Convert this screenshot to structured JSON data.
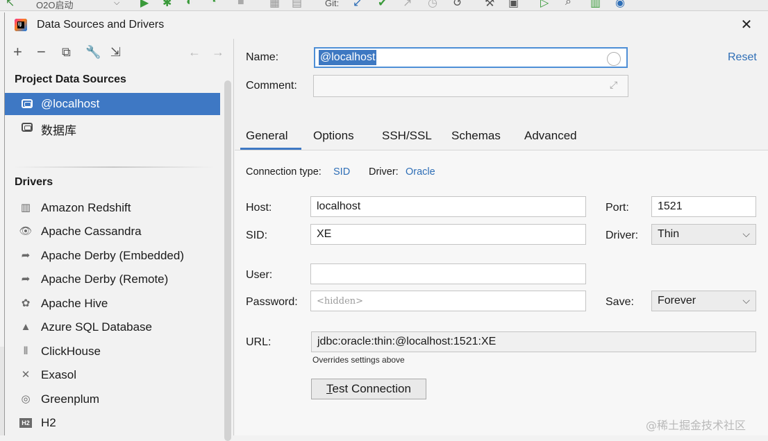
{
  "ide_toolbar": {
    "project_selector": "O2O启动",
    "git_label": "Git:"
  },
  "dialog": {
    "title": "Data Sources and Drivers",
    "close_glyph": "✕"
  },
  "left_toolbar": {
    "icons": [
      "add-icon",
      "remove-icon",
      "duplicate-icon",
      "properties-icon",
      "import-icon",
      "back-arrow-icon",
      "forward-arrow-icon"
    ]
  },
  "project_data_sources": {
    "header": "Project Data Sources",
    "items": [
      {
        "label": "@localhost",
        "selected": true
      },
      {
        "label": "数据库",
        "selected": false
      }
    ]
  },
  "drivers": {
    "header": "Drivers",
    "items": [
      {
        "label": "Amazon Redshift",
        "icon": "redshift-icon"
      },
      {
        "label": "Apache Cassandra",
        "icon": "cassandra-icon"
      },
      {
        "label": "Apache Derby (Embedded)",
        "icon": "derby-icon"
      },
      {
        "label": "Apache Derby (Remote)",
        "icon": "derby-icon"
      },
      {
        "label": "Apache Hive",
        "icon": "hive-icon"
      },
      {
        "label": "Azure SQL Database",
        "icon": "azure-icon"
      },
      {
        "label": "ClickHouse",
        "icon": "clickhouse-icon"
      },
      {
        "label": "Exasol",
        "icon": "exasol-icon"
      },
      {
        "label": "Greenplum",
        "icon": "greenplum-icon"
      },
      {
        "label": "H2",
        "icon": "h2-icon"
      }
    ]
  },
  "form": {
    "name_label": "Name:",
    "name_value": "@localhost",
    "comment_label": "Comment:",
    "comment_value": "",
    "reset_label": "Reset"
  },
  "tabs": [
    {
      "label": "General",
      "active": true
    },
    {
      "label": "Options",
      "active": false
    },
    {
      "label": "SSH/SSL",
      "active": false
    },
    {
      "label": "Schemas",
      "active": false
    },
    {
      "label": "Advanced",
      "active": false
    }
  ],
  "general": {
    "connection_type_label": "Connection type:",
    "connection_type_value": "SID",
    "driver_link_label": "Driver:",
    "driver_link_value": "Oracle",
    "host_label": "Host:",
    "host_value": "localhost",
    "port_label": "Port:",
    "port_value": "1521",
    "sid_label": "SID:",
    "sid_value": "XE",
    "driver_label": "Driver:",
    "driver_value": "Thin",
    "user_label": "User:",
    "user_value": "",
    "password_label": "Password:",
    "password_placeholder": "<hidden>",
    "save_label": "Save:",
    "save_value": "Forever",
    "url_label": "URL:",
    "url_value": "jdbc:oracle:thin:@localhost:1521:XE",
    "overrides_note": "Overrides settings above",
    "test_button_first": "T",
    "test_button_rest": "est Connection"
  },
  "watermark": "@稀土掘金技术社区",
  "colors": {
    "accent": "#3e78c4",
    "link": "#2e6eb6",
    "background": "#f2f2f2"
  }
}
